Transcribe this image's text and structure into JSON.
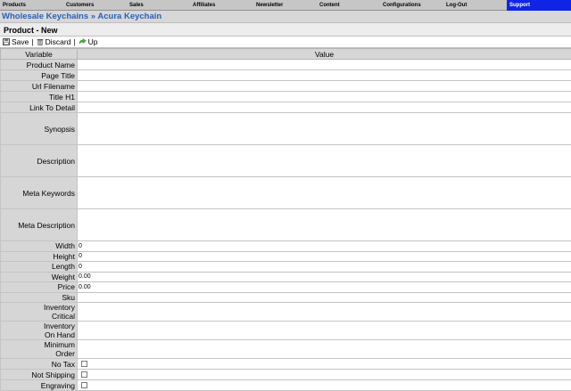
{
  "nav": {
    "items": [
      {
        "label": "Products"
      },
      {
        "label": "Customers"
      },
      {
        "label": "Sales"
      },
      {
        "label": "Affiliates"
      },
      {
        "label": "Newsletter"
      },
      {
        "label": "Content"
      },
      {
        "label": "Configurations"
      },
      {
        "label": "Log-Out"
      },
      {
        "label": "Support"
      }
    ]
  },
  "breadcrumb": {
    "first": "Wholesale Keychains",
    "separator": "»",
    "second": "Acura Keychain"
  },
  "page": {
    "title": "Product - New"
  },
  "toolbar": {
    "save_label": "Save",
    "discard_label": "Discard",
    "up_label": "Up",
    "separator": "|"
  },
  "table": {
    "headers": {
      "variable": "Variable",
      "value": "Value"
    },
    "rows": [
      {
        "label": "Product Name",
        "value": ""
      },
      {
        "label": "Page Title",
        "value": ""
      },
      {
        "label": "Url Filename",
        "value": ""
      },
      {
        "label": "Title H1",
        "value": ""
      },
      {
        "label": "Link To Detail",
        "value": ""
      },
      {
        "label": "Synopsis",
        "value": ""
      },
      {
        "label": "Description",
        "value": ""
      },
      {
        "label": "Meta Keywords",
        "value": ""
      },
      {
        "label": "Meta Description",
        "value": ""
      },
      {
        "label": "Width",
        "value": "0"
      },
      {
        "label": "Height",
        "value": "0"
      },
      {
        "label": "Length",
        "value": "0"
      },
      {
        "label": "Weight",
        "value": "0.00"
      },
      {
        "label": "Price",
        "value": "0.00"
      },
      {
        "label": "Sku",
        "value": ""
      },
      {
        "label_line1": "Inventory",
        "label_line2": "Critical",
        "value": ""
      },
      {
        "label_line1": "Inventory",
        "label_line2": "On Hand",
        "value": ""
      },
      {
        "label_line1": "Minimum",
        "label_line2": "Order",
        "value": ""
      },
      {
        "label": "No Tax",
        "checked": false
      },
      {
        "label": "Not Shipping",
        "checked": false
      },
      {
        "label": "Engraving",
        "checked": false
      }
    ]
  },
  "colors": {
    "nav_bg": "#c6c6c6",
    "nav_active": "#1024e6",
    "link": "#2a5fb9",
    "label_bg": "#d6d6d6"
  }
}
